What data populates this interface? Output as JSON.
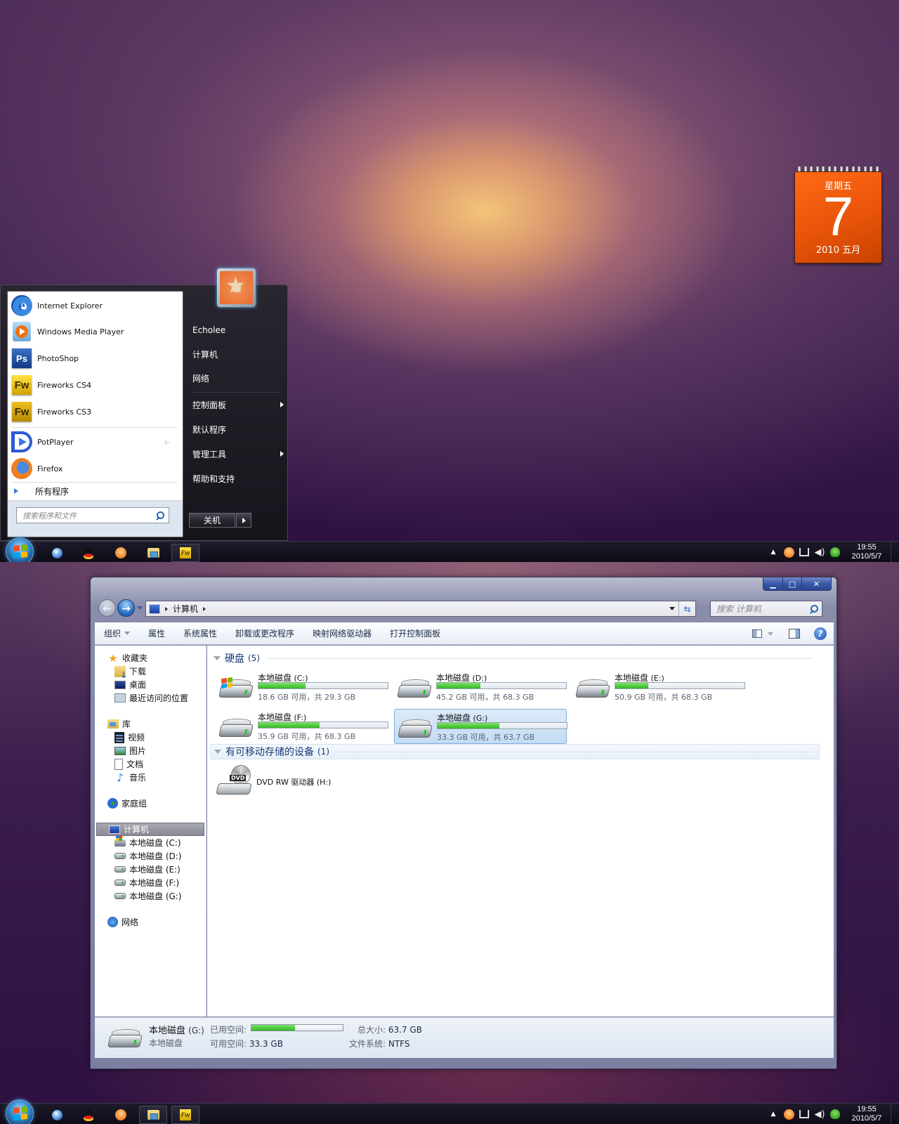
{
  "desktop_top": {
    "calendar": {
      "weekday": "星期五",
      "day": "7",
      "year_month": "2010 五月"
    },
    "start_menu": {
      "pinned": [
        {
          "label": "Internet Explorer",
          "icon": "internet-explorer-icon"
        },
        {
          "label": "Windows Media Player",
          "icon": "windows-media-player-icon"
        },
        {
          "label": "PhotoShop",
          "icon": "photoshop-icon",
          "glyph": "Ps"
        },
        {
          "label": "Fireworks CS4",
          "icon": "fireworks-icon",
          "glyph": "Fw"
        },
        {
          "label": "Fireworks CS3",
          "icon": "fireworks-icon",
          "glyph": "Fw"
        }
      ],
      "recent": [
        {
          "label": "PotPlayer",
          "icon": "potplayer-icon",
          "has_submenu": true
        },
        {
          "label": "Firefox",
          "icon": "firefox-icon"
        }
      ],
      "all_programs": "所有程序",
      "search_placeholder": "搜索程序和文件",
      "right_items": [
        {
          "label": "Echolee",
          "submenu": false
        },
        {
          "label": "计算机",
          "submenu": false
        },
        {
          "label": "网络",
          "submenu": false
        },
        {
          "label": "控制面板",
          "submenu": true
        },
        {
          "label": "默认程序",
          "submenu": false
        },
        {
          "label": "管理工具",
          "submenu": true
        },
        {
          "label": "帮助和支持",
          "submenu": false
        }
      ],
      "shutdown_label": "关机"
    }
  },
  "taskbar": {
    "apps": [
      {
        "name": "browser-globe"
      },
      {
        "name": "qq"
      },
      {
        "name": "music-headphones"
      },
      {
        "name": "windows-explorer"
      },
      {
        "name": "fireworks",
        "glyph": "Fw"
      }
    ],
    "clock_time": "19:55",
    "clock_date": "2010/5/7"
  },
  "explorer": {
    "address": {
      "location": "计算机"
    },
    "search_placeholder": "搜索 计算机",
    "window_controls": {
      "minimize": "▁",
      "maximize": "□",
      "close": "✕"
    },
    "commands": [
      "组织",
      "属性",
      "系统属性",
      "卸载或更改程序",
      "映射网络驱动器",
      "打开控制面板"
    ],
    "nav": {
      "favorites": {
        "label": "收藏夹",
        "items": [
          "下载",
          "桌面",
          "最近访问的位置"
        ]
      },
      "libraries": {
        "label": "库",
        "items": [
          "视频",
          "图片",
          "文档",
          "音乐"
        ]
      },
      "homegroup": "家庭组",
      "computer": {
        "label": "计算机",
        "items": [
          "本地磁盘 (C:)",
          "本地磁盘 (D:)",
          "本地磁盘 (E:)",
          "本地磁盘 (F:)",
          "本地磁盘 (G:)"
        ]
      },
      "network": "网络"
    },
    "groups": {
      "hdd": {
        "title": "硬盘",
        "count": "(5)"
      },
      "removable": {
        "title": "有可移动存储的设备",
        "count": "(1)"
      }
    },
    "drives": [
      {
        "name": "本地磁盘",
        "letter": "(C:)",
        "status": "18.6 GB 可用，共 29.3 GB",
        "used_fraction": 0.365,
        "system": true
      },
      {
        "name": "本地磁盘",
        "letter": "(D:)",
        "status": "45.2 GB 可用，共 68.3 GB",
        "used_fraction": 0.338
      },
      {
        "name": "本地磁盘",
        "letter": "(E:)",
        "status": "50.9 GB 可用，共 68.3 GB",
        "used_fraction": 0.255
      },
      {
        "name": "本地磁盘",
        "letter": "(F:)",
        "status": "35.9 GB 可用，共 68.3 GB",
        "used_fraction": 0.474
      },
      {
        "name": "本地磁盘",
        "letter": "(G:)",
        "status": "33.3 GB 可用，共 63.7 GB",
        "used_fraction": 0.477,
        "selected": true
      }
    ],
    "dvd": {
      "label": "DVD RW 驱动器 (H:)",
      "badge": "DVD"
    },
    "details": {
      "name": "本地磁盘",
      "letter": "(G:)",
      "type": "本地磁盘",
      "used_label": "已用空间:",
      "used_fraction": 0.477,
      "free_label": "可用空间:",
      "free_value": "33.3 GB",
      "total_label": "总大小:",
      "total_value": "63.7 GB",
      "fs_label": "文件系统:",
      "fs_value": "NTFS"
    }
  },
  "colors": {
    "calendar_orange": "#e8540a",
    "progress_green": "#34b824",
    "selection_blue": "#c4dcf4"
  }
}
